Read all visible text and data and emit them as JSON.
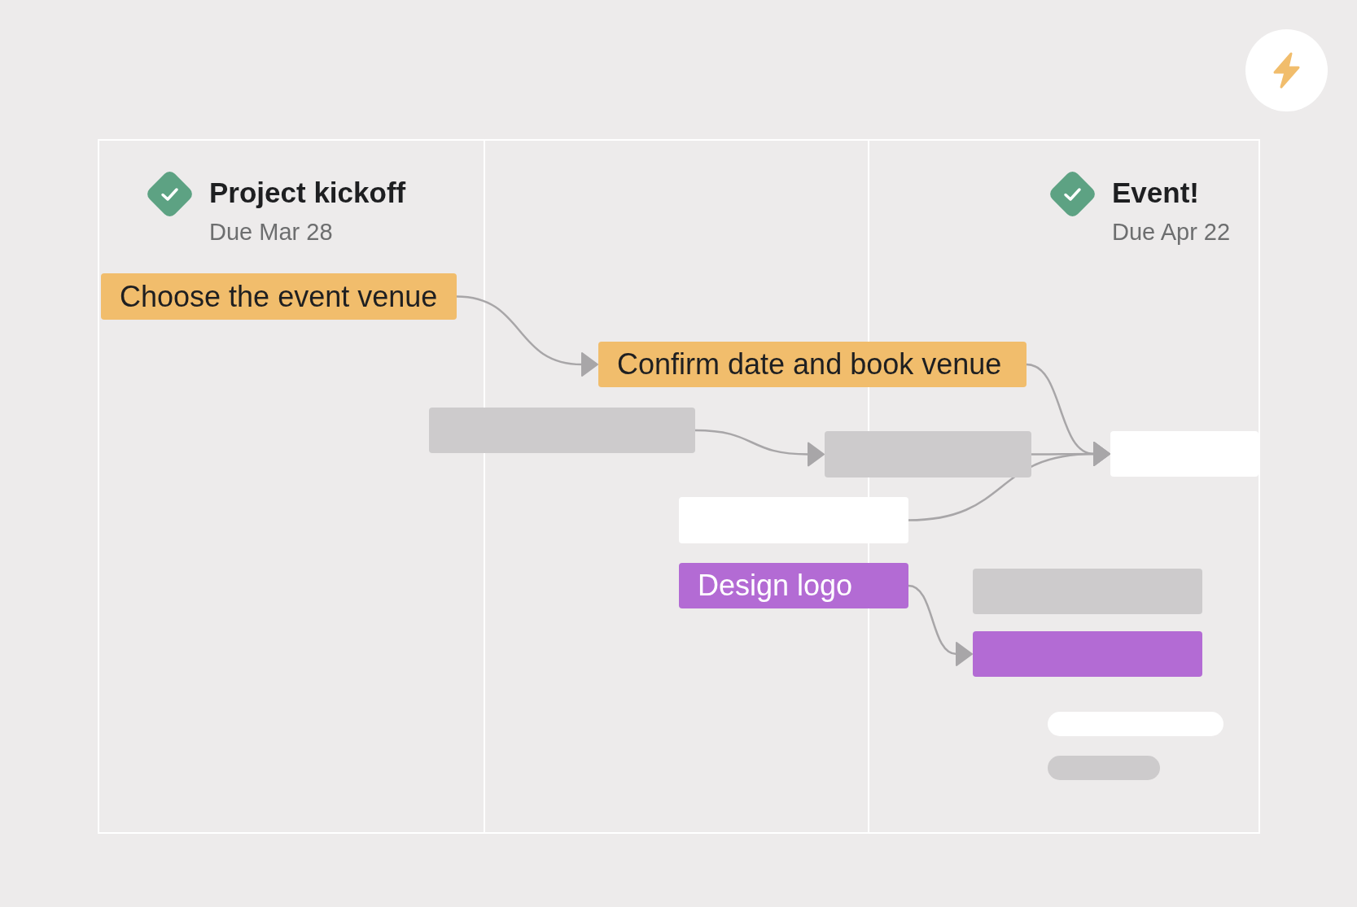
{
  "timeline": {
    "milestones": [
      {
        "title": "Project kickoff",
        "due": "Due Mar 28",
        "completed": true
      },
      {
        "title": "Event!",
        "due": "Due Apr 22",
        "completed": true
      }
    ],
    "tasks": [
      {
        "label": "Choose the event venue",
        "color": "#f1bd6c"
      },
      {
        "label": "Confirm date and book venue",
        "color": "#f1bd6c"
      },
      {
        "color": "#cdcbcc"
      },
      {
        "color": "#cdcbcc"
      },
      {
        "color": "#ffffff"
      },
      {
        "color": "#ffffff"
      },
      {
        "label": "Design logo",
        "color": "#b36bd4"
      },
      {
        "color": "#cdcbcc"
      },
      {
        "color": "#b36bd4"
      }
    ],
    "placeholder_lines": [
      {
        "color": "#ffffff"
      },
      {
        "color": "#cdcbcc"
      }
    ]
  }
}
